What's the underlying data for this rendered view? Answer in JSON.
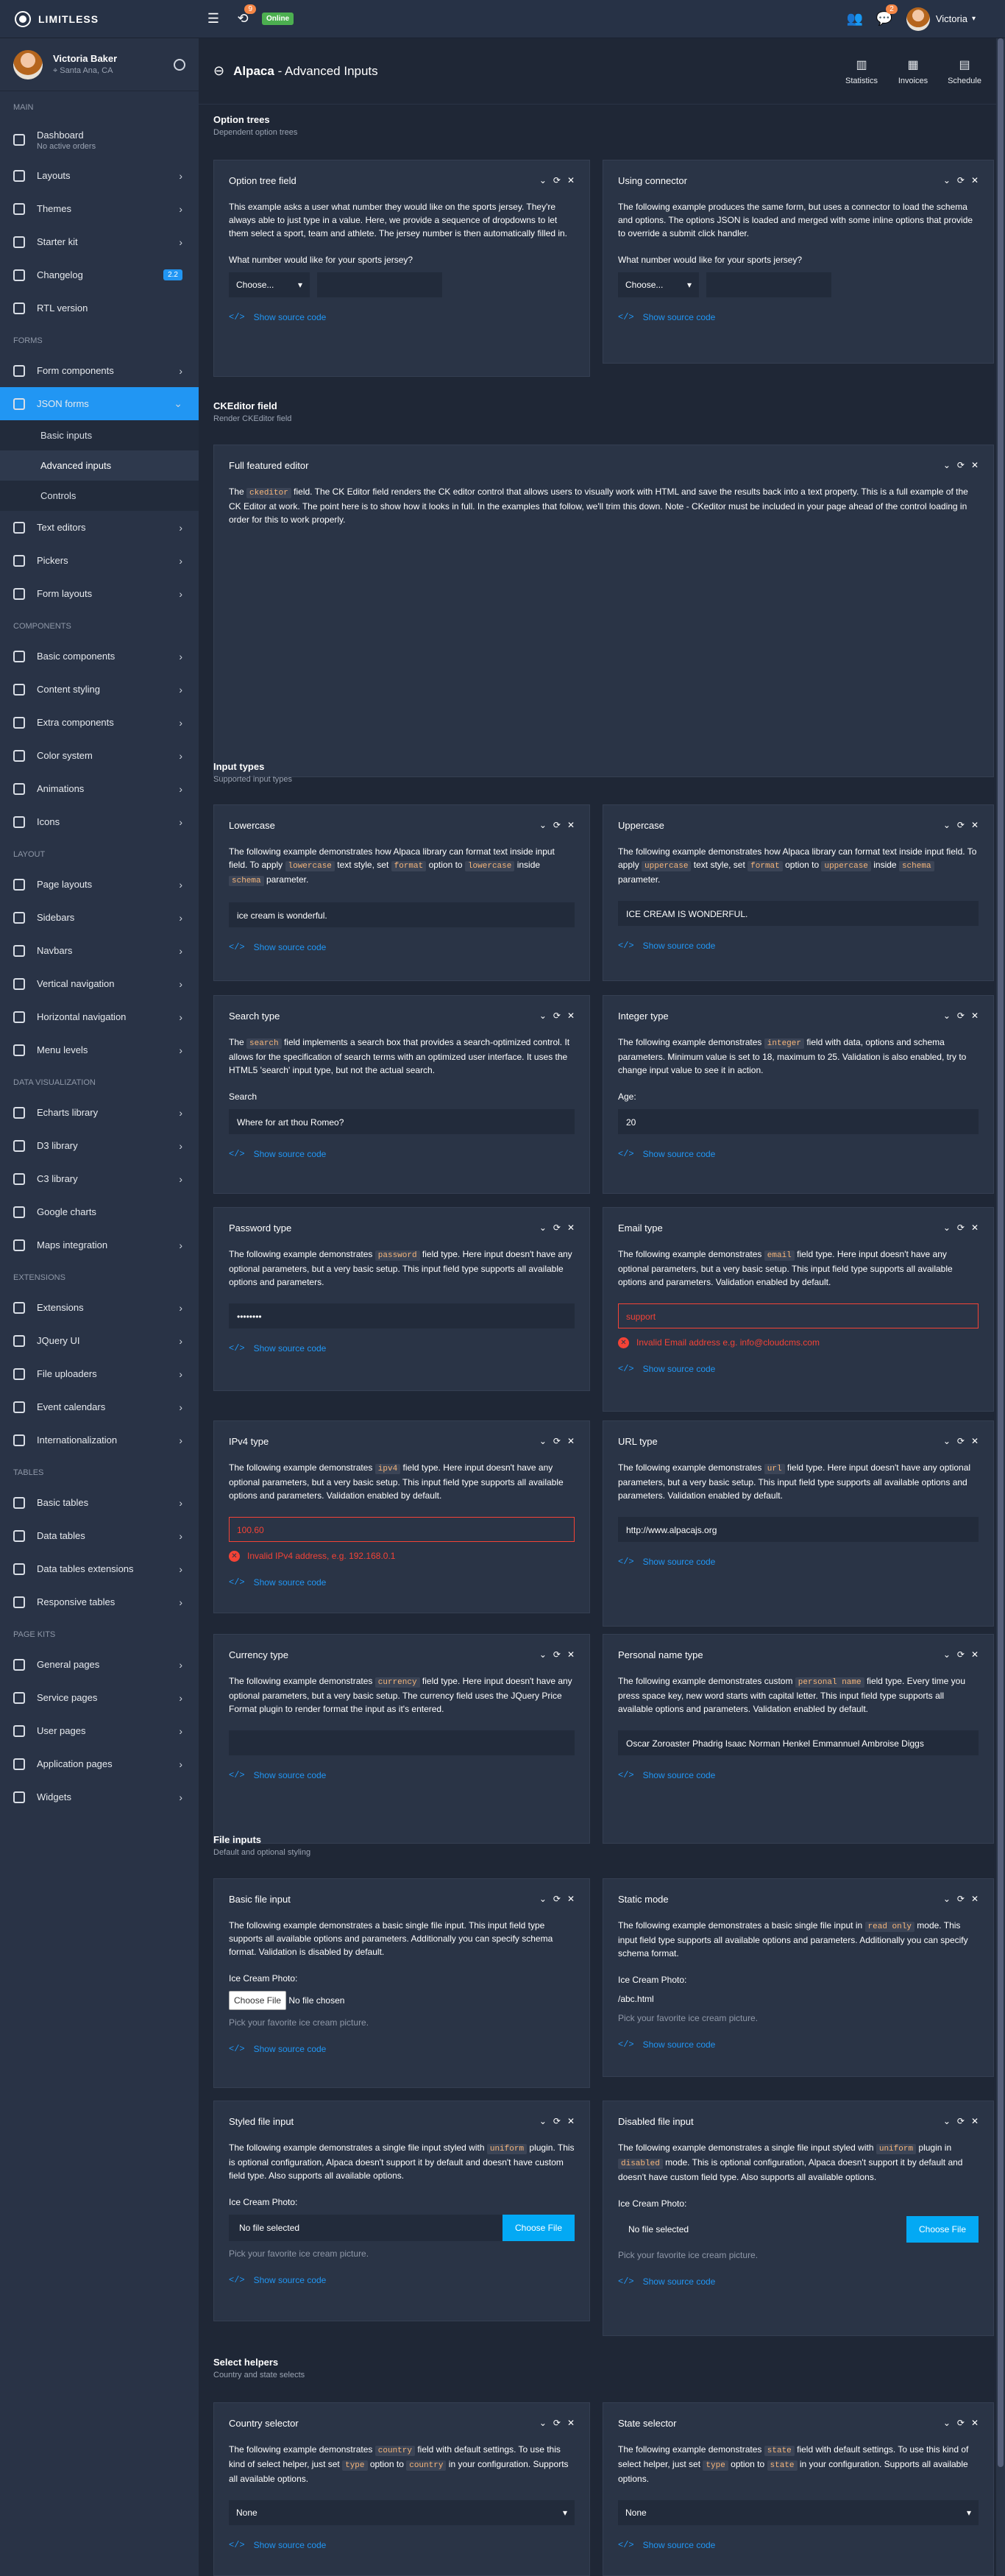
{
  "navbar": {
    "brand": "LIMITLESS",
    "notif_count": "9",
    "online": "Online",
    "msg_count": "2",
    "user": "Victoria"
  },
  "sidebar": {
    "user_name": "Victoria Baker",
    "user_loc": "Santa Ana, CA",
    "main": "Main",
    "dashboard": "Dashboard",
    "dashboard_sub": "No active orders",
    "layouts": "Layouts",
    "themes": "Themes",
    "starter": "Starter kit",
    "changelog": "Changelog",
    "changelog_badge": "2.2",
    "rtl": "RTL version",
    "forms": "Forms",
    "form_components": "Form components",
    "json_forms": "JSON forms",
    "basic_inputs": "Basic inputs",
    "advanced_inputs": "Advanced inputs",
    "controls": "Controls",
    "text_editors": "Text editors",
    "pickers": "Pickers",
    "form_layouts": "Form layouts",
    "components": "Components",
    "basic_components": "Basic components",
    "content_styling": "Content styling",
    "extra_components": "Extra components",
    "color_system": "Color system",
    "animations": "Animations",
    "icons": "Icons",
    "layout": "Layout",
    "page_layouts": "Page layouts",
    "sidebars": "Sidebars",
    "navbars": "Navbars",
    "vnav": "Vertical navigation",
    "hnav": "Horizontal navigation",
    "menu_levels": "Menu levels",
    "dataviz": "Data visualization",
    "echarts": "Echarts library",
    "d3": "D3 library",
    "c3": "C3 library",
    "google_charts": "Google charts",
    "maps": "Maps integration",
    "extensions_h": "Extensions",
    "extensions": "Extensions",
    "jquery_ui": "JQuery UI",
    "file_uploaders": "File uploaders",
    "event_calendars": "Event calendars",
    "i18n": "Internationalization",
    "tables": "Tables",
    "basic_tables": "Basic tables",
    "data_tables": "Data tables",
    "dt_ext": "Data tables extensions",
    "responsive_tables": "Responsive tables",
    "page_kits": "Page kits",
    "general_pages": "General pages",
    "service_pages": "Service pages",
    "user_pages": "User pages",
    "app_pages": "Application pages",
    "widgets": "Widgets"
  },
  "header": {
    "title": "Alpaca",
    "subtitle": " - Advanced Inputs",
    "statistics": "Statistics",
    "invoices": "Invoices",
    "schedule": "Schedule"
  },
  "sections": {
    "option_trees": "Option trees",
    "option_trees_sub": "Dependent option trees",
    "ckeditor": "CKEditor field",
    "ckeditor_sub": "Render CKEditor field",
    "input_types": "Input types",
    "input_types_sub": "Supported input types",
    "file_inputs": "File inputs",
    "file_inputs_sub": "Default and optional styling",
    "select_helpers": "Select helpers",
    "select_helpers_sub": "Country and state selects"
  },
  "show_source": "Show source code",
  "cards": {
    "ot1": {
      "title": "Option tree field",
      "body": "This example asks a user what number they would like on the sports jersey. They're always able to just type in a value. Here, we provide a sequence of dropdowns to let them select a sport, team and athlete. The jersey number is then automatically filled in.",
      "label": "What number would like for your sports jersey?",
      "select": "Choose..."
    },
    "ot2": {
      "title": "Using connector",
      "body": "The following example produces the same form, but uses a connector to load the schema and options. The options JSON is loaded and merged with some inline options that provide to override a submit click handler.",
      "label": "What number would like for your sports jersey?",
      "select": "Choose..."
    },
    "ck": {
      "title": "Full featured editor",
      "pre": "The ",
      "code": "ckeditor",
      "body": " field. The CK Editor field renders the CK editor control that allows users to visually work with HTML and save the results back into a text property. This is a full example of the CK Editor at work. The point here is to show how it looks in full. In the examples that follow, we'll trim this down. Note - CKeditor must be included in your page ahead of the control loading in order for this to work properly."
    },
    "lower": {
      "title": "Lowercase",
      "t1": "The following example demonstrates how Alpaca library can format text inside input field. To apply ",
      "c1": "lowercase",
      "t2": " text style, set ",
      "c2": "format",
      "t3": " option to ",
      "c3": "lowercase",
      "t4": " inside ",
      "c4": "schema",
      "t5": " parameter.",
      "value": "ice cream is wonderful."
    },
    "upper": {
      "title": "Uppercase",
      "t1": "The following example demonstrates how Alpaca library can format text inside input field. To apply ",
      "c1": "uppercase",
      "t2": " text style, set ",
      "c2": "format",
      "t3": " option to ",
      "c3": "uppercase",
      "t4": " inside ",
      "c4": "schema",
      "t5": " parameter.",
      "value": "ICE CREAM IS WONDERFUL."
    },
    "search": {
      "title": "Search type",
      "t1": "The ",
      "c1": "search",
      "t2": " field implements a search box that provides a search-optimized control. It allows for the specification of search terms with an optimized user interface. It uses the HTML5 'search' input type, but not the actual search.",
      "label": "Search",
      "value": "Where for art thou Romeo?"
    },
    "integer": {
      "title": "Integer type",
      "t1": "The following example demonstrates ",
      "c1": "integer",
      "t2": " field with data, options and schema parameters. Minimum value is set to 18, maximum to 25. Validation is also enabled, try to change input value to see it in action.",
      "label": "Age:",
      "value": "20"
    },
    "password": {
      "title": "Password type",
      "t1": "The following example demonstrates ",
      "c1": "password",
      "t2": " field type. Here input doesn't have any optional parameters, but a very basic setup. This input field type supports all available options and parameters.",
      "value": "••••••••"
    },
    "email": {
      "title": "Email type",
      "t1": "The following example demonstrates ",
      "c1": "email",
      "t2": " field type. Here input doesn't have any optional parameters, but a very basic setup. This input field type supports all available options and parameters. Validation enabled by default.",
      "value": "support",
      "error": "Invalid Email address e.g. info@cloudcms.com"
    },
    "ipv4": {
      "title": "IPv4 type",
      "t1": "The following example demonstrates ",
      "c1": "ipv4",
      "t2": " field type. Here input doesn't have any optional parameters, but a very basic setup. This input field type supports all available options and parameters. Validation enabled by default.",
      "value": "100.60",
      "error": "Invalid IPv4 address, e.g. 192.168.0.1"
    },
    "url": {
      "title": "URL type",
      "t1": "The following example demonstrates ",
      "c1": "url",
      "t2": " field type. Here input doesn't have any optional parameters, but a very basic setup. This input field type supports all available options and parameters. Validation enabled by default.",
      "value": "http://www.alpacajs.org"
    },
    "currency": {
      "title": "Currency type",
      "t1": "The following example demonstrates ",
      "c1": "currency",
      "t2": " field type. Here input doesn't have any optional parameters, but a very basic setup. The currency field uses the JQuery Price Format plugin to render format the input as it's entered.",
      "value": ""
    },
    "pname": {
      "title": "Personal name type",
      "t1": "The following example demonstrates custom ",
      "c1": "personal name",
      "t2": " field type. Every time you press space key, new word starts with capital letter. This input field type supports all available options and parameters. Validation enabled by default.",
      "value": "Oscar Zoroaster Phadrig Isaac Norman Henkel Emmannuel Ambroise Diggs"
    },
    "basicfile": {
      "title": "Basic file input",
      "body": "The following example demonstrates a basic single file input. This input field type supports all available options and parameters. Additionally you can specify schema format. Validation is disabled by default.",
      "label": "Ice Cream Photo:",
      "btn": "Choose File",
      "nofile": "No file chosen",
      "help": "Pick your favorite ice cream picture."
    },
    "static": {
      "title": "Static mode",
      "t1": "The following example demonstrates a basic single file input in ",
      "c1": "read only",
      "t2": " mode. This input field type supports all available options and parameters. Additionally you can specify schema format.",
      "label": "Ice Cream Photo:",
      "value": "/abc.html",
      "help": "Pick your favorite ice cream picture."
    },
    "styled": {
      "title": "Styled file input",
      "t1": "The following example demonstrates a single file input styled with ",
      "c1": "uniform",
      "t2": " plugin. This is optional configuration, Alpaca doesn't support it by default and doesn't have custom field type. Also supports all available options.",
      "label": "Ice Cream Photo:",
      "nofile": "No file selected",
      "btn": "Choose File",
      "help": "Pick your favorite ice cream picture."
    },
    "disabled": {
      "title": "Disabled file input",
      "t1": "The following example demonstrates a single file input styled with ",
      "c1": "uniform",
      "t2": " plugin in ",
      "c2": "disabled",
      "t3": " mode. This is optional configuration, Alpaca doesn't support it by default and doesn't have custom field type. Also supports all available options.",
      "label": "Ice Cream Photo:",
      "nofile": "No file selected",
      "btn": "Choose File",
      "help": "Pick your favorite ice cream picture."
    },
    "country": {
      "title": "Country selector",
      "t1": "The following example demonstrates ",
      "c1": "country",
      "t2": " field with default settings. To use this kind of select helper, just set ",
      "c2": "type",
      "t3": " option to ",
      "c3": "country",
      "t4": " in your configuration. Supports all available options.",
      "value": "None"
    },
    "state": {
      "title": "State selector",
      "t1": "The following example demonstrates ",
      "c1": "state",
      "t2": " field with default settings. To use this kind of select helper, just set ",
      "c2": "type",
      "t3": " option to ",
      "c3": "state",
      "t4": " in your configuration. Supports all available options.",
      "value": "None"
    }
  }
}
